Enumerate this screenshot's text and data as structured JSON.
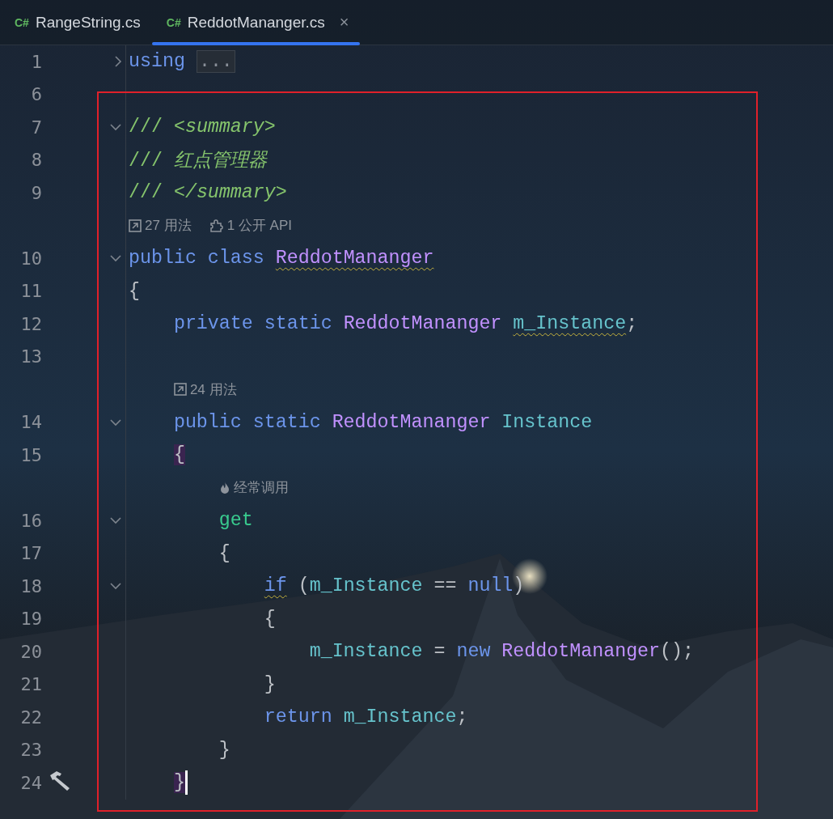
{
  "tabs": [
    {
      "icon": "C#",
      "label": "RangeString.cs",
      "selected": false,
      "closable": false
    },
    {
      "icon": "C#",
      "label": "ReddotMananger.cs",
      "selected": true,
      "closable": true,
      "close": "×"
    }
  ],
  "rows": [
    {
      "kind": "code",
      "number": "1",
      "folded": true,
      "tokens": [
        {
          "kind": "keyword",
          "text": "using"
        },
        {
          "kind": "folded",
          "text": "..."
        }
      ]
    },
    {
      "kind": "code",
      "number": "6",
      "tokens": []
    },
    {
      "kind": "code",
      "number": "7",
      "folded": false,
      "tokens": [
        {
          "kind": "comment",
          "text": "/// "
        },
        {
          "kind": "doctag",
          "text": "<summary>"
        }
      ]
    },
    {
      "kind": "code",
      "number": "8",
      "tokens": [
        {
          "kind": "comment",
          "text": "/// "
        },
        {
          "kind": "doctext",
          "text": "红点管理器"
        }
      ]
    },
    {
      "kind": "code",
      "number": "9",
      "tokens": [
        {
          "kind": "comment",
          "text": "/// "
        },
        {
          "kind": "doctag",
          "text": "</summary>"
        }
      ]
    },
    {
      "kind": "hint",
      "items": [
        {
          "kind": "usages",
          "text": "27 用法"
        },
        {
          "kind": "api",
          "text": "1 公开 API"
        }
      ]
    },
    {
      "kind": "code",
      "number": "10",
      "folded": false,
      "tokens": [
        {
          "kind": "keyword",
          "text": "public class "
        },
        {
          "kind": "type",
          "text": "ReddotMananger",
          "warning": true
        }
      ]
    },
    {
      "kind": "code",
      "number": "11",
      "tokens": [
        {
          "kind": "punct",
          "text": "{"
        }
      ]
    },
    {
      "kind": "code",
      "number": "12",
      "tokens": [
        {
          "kind": "keyword",
          "text": "private static "
        },
        {
          "kind": "type",
          "text": "ReddotMananger "
        },
        {
          "kind": "field",
          "text": "m_Instance",
          "warning": true
        },
        {
          "kind": "punct",
          "text": ";"
        }
      ]
    },
    {
      "kind": "code",
      "number": "13",
      "tokens": []
    },
    {
      "kind": "hint",
      "items": [
        {
          "kind": "usages",
          "text": "24 用法"
        }
      ]
    },
    {
      "kind": "code",
      "number": "14",
      "folded": false,
      "tokens": [
        {
          "kind": "keyword",
          "text": "public static "
        },
        {
          "kind": "type",
          "text": "ReddotMananger "
        },
        {
          "kind": "field",
          "text": "Instance"
        }
      ]
    },
    {
      "kind": "code",
      "number": "15",
      "tokens": [
        {
          "kind": "punct",
          "text": "{",
          "matched": true
        }
      ]
    },
    {
      "kind": "hint",
      "items": [
        {
          "kind": "hot",
          "text": "经常调用"
        }
      ]
    },
    {
      "kind": "code",
      "number": "16",
      "folded": false,
      "tokens": [
        {
          "kind": "accessor",
          "text": "get"
        }
      ]
    },
    {
      "kind": "code",
      "number": "17",
      "tokens": [
        {
          "kind": "punct",
          "text": "{"
        }
      ]
    },
    {
      "kind": "code",
      "number": "18",
      "folded": false,
      "tokens": [
        {
          "kind": "keyword",
          "text": "if",
          "warning": true
        },
        {
          "kind": "punct",
          "text": " ("
        },
        {
          "kind": "field",
          "text": "m_Instance"
        },
        {
          "kind": "punct",
          "text": " == "
        },
        {
          "kind": "keyword",
          "text": "null"
        },
        {
          "kind": "punct",
          "text": ")"
        }
      ]
    },
    {
      "kind": "code",
      "number": "19",
      "tokens": [
        {
          "kind": "punct",
          "text": "{"
        }
      ]
    },
    {
      "kind": "code",
      "number": "20",
      "tokens": [
        {
          "kind": "field",
          "text": "m_Instance"
        },
        {
          "kind": "punct",
          "text": " = "
        },
        {
          "kind": "keyword",
          "text": "new "
        },
        {
          "kind": "type",
          "text": "ReddotMananger"
        },
        {
          "kind": "punct",
          "text": "();"
        }
      ]
    },
    {
      "kind": "code",
      "number": "21",
      "tokens": [
        {
          "kind": "punct",
          "text": "}"
        }
      ]
    },
    {
      "kind": "code",
      "number": "22",
      "tokens": [
        {
          "kind": "keyword",
          "text": "return "
        },
        {
          "kind": "field",
          "text": "m_Instance"
        },
        {
          "kind": "punct",
          "text": ";"
        }
      ]
    },
    {
      "kind": "code",
      "number": "23",
      "tokens": [
        {
          "kind": "punct",
          "text": "}"
        }
      ]
    },
    {
      "kind": "code",
      "number": "24",
      "run_marker": true,
      "caret": true,
      "tokens": [
        {
          "kind": "punct",
          "text": "}",
          "matched": true
        }
      ]
    }
  ]
}
